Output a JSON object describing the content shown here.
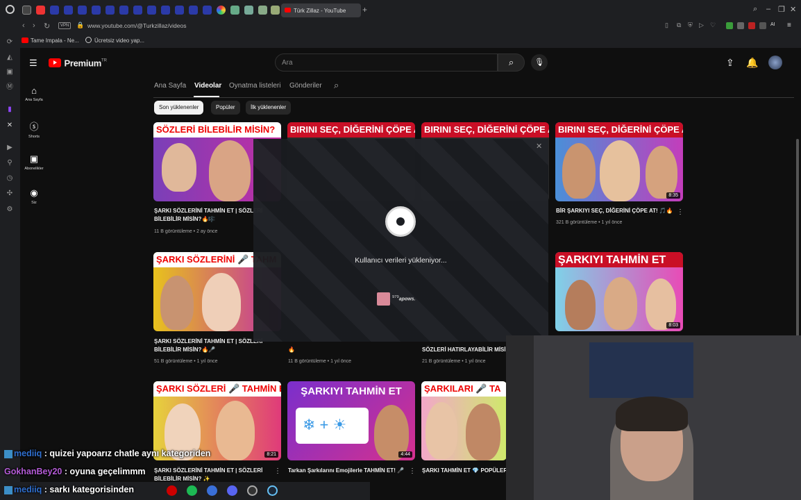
{
  "browser": {
    "active_tab_title": "Türk Zillaz - YouTube",
    "url": "www.youtube.com/@Turkzillaz/videos",
    "vpn_label": "VPN",
    "bookmarks": [
      "Tame Impala - Ne...",
      "Ücretsiz video yap..."
    ],
    "ai_label": "AI"
  },
  "youtube": {
    "logo_text": "Premium",
    "logo_sup": "TR",
    "search_placeholder": "Ara",
    "guide": [
      {
        "label": "Ana Sayfa",
        "icon": "home-icon"
      },
      {
        "label": "Shorts",
        "icon": "shorts-icon"
      },
      {
        "label": "Abonelikler",
        "icon": "subscriptions-icon"
      },
      {
        "label": "Siz",
        "icon": "you-icon"
      }
    ],
    "channel_tabs": [
      "Ana Sayfa",
      "Videolar",
      "Oynatma listeleri",
      "Gönderiler"
    ],
    "chips": [
      "Son yüklenenler",
      "Popüler",
      "İlk yüklenenler"
    ],
    "videos": [
      {
        "band": "SÖZLERİ BİLEBİLİR MİSİN?",
        "title": "ŞARKI SÖZLERİNİ TAHMİN ET | SÖZLERİ BİLEBİLİR MİSİN?🔥🎼",
        "meta": "11 B görüntüleme • 2 ay önce",
        "duration": ""
      },
      {
        "band": "BIRINI SEÇ, DİĞERİNİ ÇÖPE AT",
        "title": "",
        "meta": "",
        "duration": ""
      },
      {
        "band": "BIRINI SEÇ, DİĞERİNİ ÇÖPE AT",
        "title": "",
        "meta": "",
        "duration": ""
      },
      {
        "band": "BIRINI SEÇ, DİĞERİNİ ÇÖPE AT",
        "title": "BİR ŞARKIYI SEÇ, DİĞERİNİ ÇÖPE AT! 🎵🔥",
        "meta": "321 B görüntüleme • 1 yıl önce",
        "duration": "8:35"
      },
      {
        "band": "ŞARKI SÖZLERİNİ 🎤 TAHM",
        "title": "ŞARKI SÖZLERİNİ TAHMİN ET | SÖZLERİ BİLEBİLİR MİSİN?🔥🎤",
        "meta": "51 B görüntüleme • 1 yıl önce",
        "duration": ""
      },
      {
        "band": "",
        "title": "🔥",
        "meta": "11 B görüntüleme • 1 yıl önce",
        "duration": ""
      },
      {
        "band": "",
        "title": "SÖZLERİ HATIRLAYABİLİR MİSİN",
        "meta": "21 B görüntüleme • 1 yıl önce",
        "duration": ""
      },
      {
        "band": "ŞARKIYI TAHMİN ET",
        "title": "",
        "meta": "",
        "duration": "8:03"
      },
      {
        "band": "ŞARKI SÖZLERİ 🎤 TAHMİN ET!",
        "title": "ŞARKI SÖZLERİNİ TAHMİN ET | SÖZLERİ BİLEBİLİR MİSİN? ✨",
        "meta": "",
        "duration": "8:21"
      },
      {
        "band": "ŞARKIYI TAHMİN ET",
        "title": "Tarkan Şarkılarını Emojilerle TAHMİN ET! 🎤",
        "meta": "",
        "duration": "4:44"
      },
      {
        "band": "ŞARKILARI 🎤 TA",
        "title": "ŞARKI TAHMİN ET 💎 POPÜLER",
        "meta": "",
        "duration": ""
      }
    ]
  },
  "steam_overlay": {
    "loading_text": "Kullanıcı verileri yükleniyor...",
    "user_level": "979",
    "user_name": "apows."
  },
  "chat": [
    {
      "user": "mediiq",
      "text": "quizei yapoarız chatle aynı kategoriden",
      "color": "#2f6fcf"
    },
    {
      "user": "GokhanBey20",
      "text": "oyuna geçelimmm",
      "color": "#b45bd6"
    },
    {
      "user": "mediiq",
      "text": "sarkı kategorisinden",
      "color": "#2f6fcf"
    }
  ]
}
